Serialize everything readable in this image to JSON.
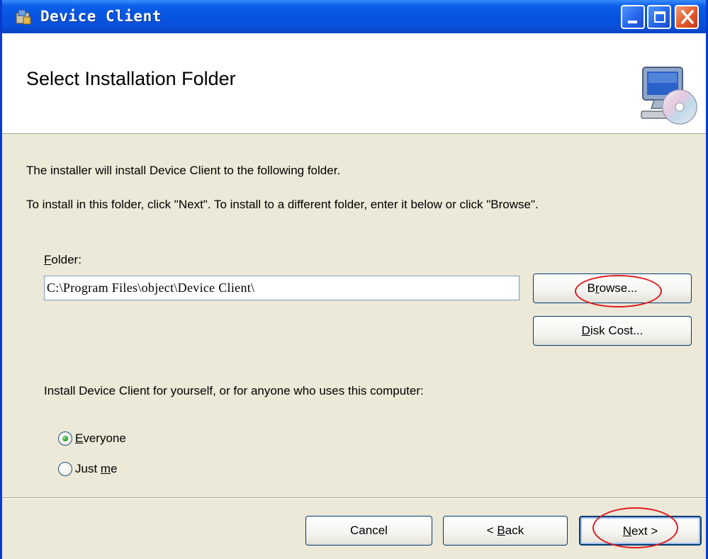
{
  "window": {
    "title": "Device Client",
    "controls": {
      "minimize": "minimize-icon",
      "maximize": "maximize-icon",
      "close": "close-icon"
    }
  },
  "header": {
    "title": "Select Installation Folder",
    "icon": "computer-cd-icon"
  },
  "body": {
    "intro": "The installer will install Device Client to the following folder.",
    "instructions": "To install in this folder, click \"Next\". To install to a different folder, enter it below or click \"Browse\".",
    "folder_label": {
      "mnemonic": "F",
      "rest": "older:"
    },
    "folder_value": "C:\\Program Files\\object\\Device Client\\",
    "browse_button": {
      "pre": "B",
      "mnemonic": "r",
      "post": "owse..."
    },
    "disk_cost_button": {
      "mnemonic": "D",
      "post": "isk Cost..."
    },
    "scope_prompt": "Install Device Client for yourself, or for anyone who uses this computer:",
    "options": {
      "everyone": {
        "mnemonic": "E",
        "rest": "veryone",
        "selected": true
      },
      "just_me": {
        "pre": "Just ",
        "mnemonic": "m",
        "rest": "e",
        "selected": false
      }
    }
  },
  "footer": {
    "cancel": "Cancel",
    "back": {
      "pre": "< ",
      "mnemonic": "B",
      "post": "ack"
    },
    "next": {
      "mnemonic": "N",
      "post": "ext >"
    }
  },
  "colors": {
    "titlebar": "#0654e0",
    "dialog_face": "#ece9d8",
    "annotation": "#e0191d"
  }
}
